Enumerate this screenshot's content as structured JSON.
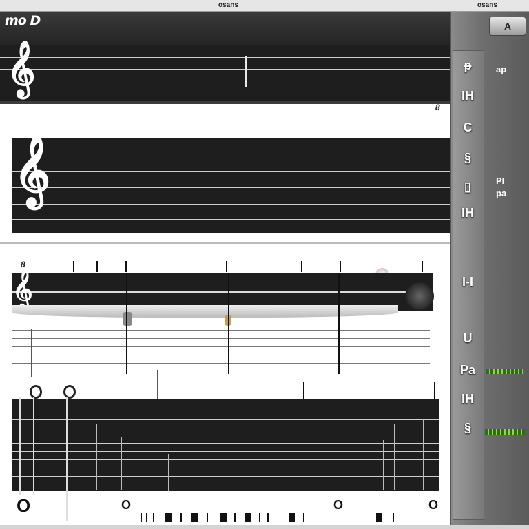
{
  "topbar": {
    "center_text": "osans",
    "right_text": "osans"
  },
  "window": {
    "title": "mo D"
  },
  "score": {
    "page_marker": "8",
    "system2_measure": "8",
    "note_heads": [
      "o",
      "o"
    ]
  },
  "bottom": {
    "symbols": [
      "O",
      "O",
      "O",
      "O"
    ]
  },
  "rail": {
    "buttons": [
      "ᵽ",
      "IH",
      "C",
      "§",
      "▯",
      "IH",
      "I-I",
      "U",
      "Pa",
      "IH",
      "§"
    ]
  },
  "side": {
    "chip_label": "A",
    "label_1": "ap",
    "label_2": "PI",
    "label_3": "pa"
  },
  "colors": {
    "accent_green": "#9ad04a",
    "staff_dark": "#1e1e1e"
  }
}
